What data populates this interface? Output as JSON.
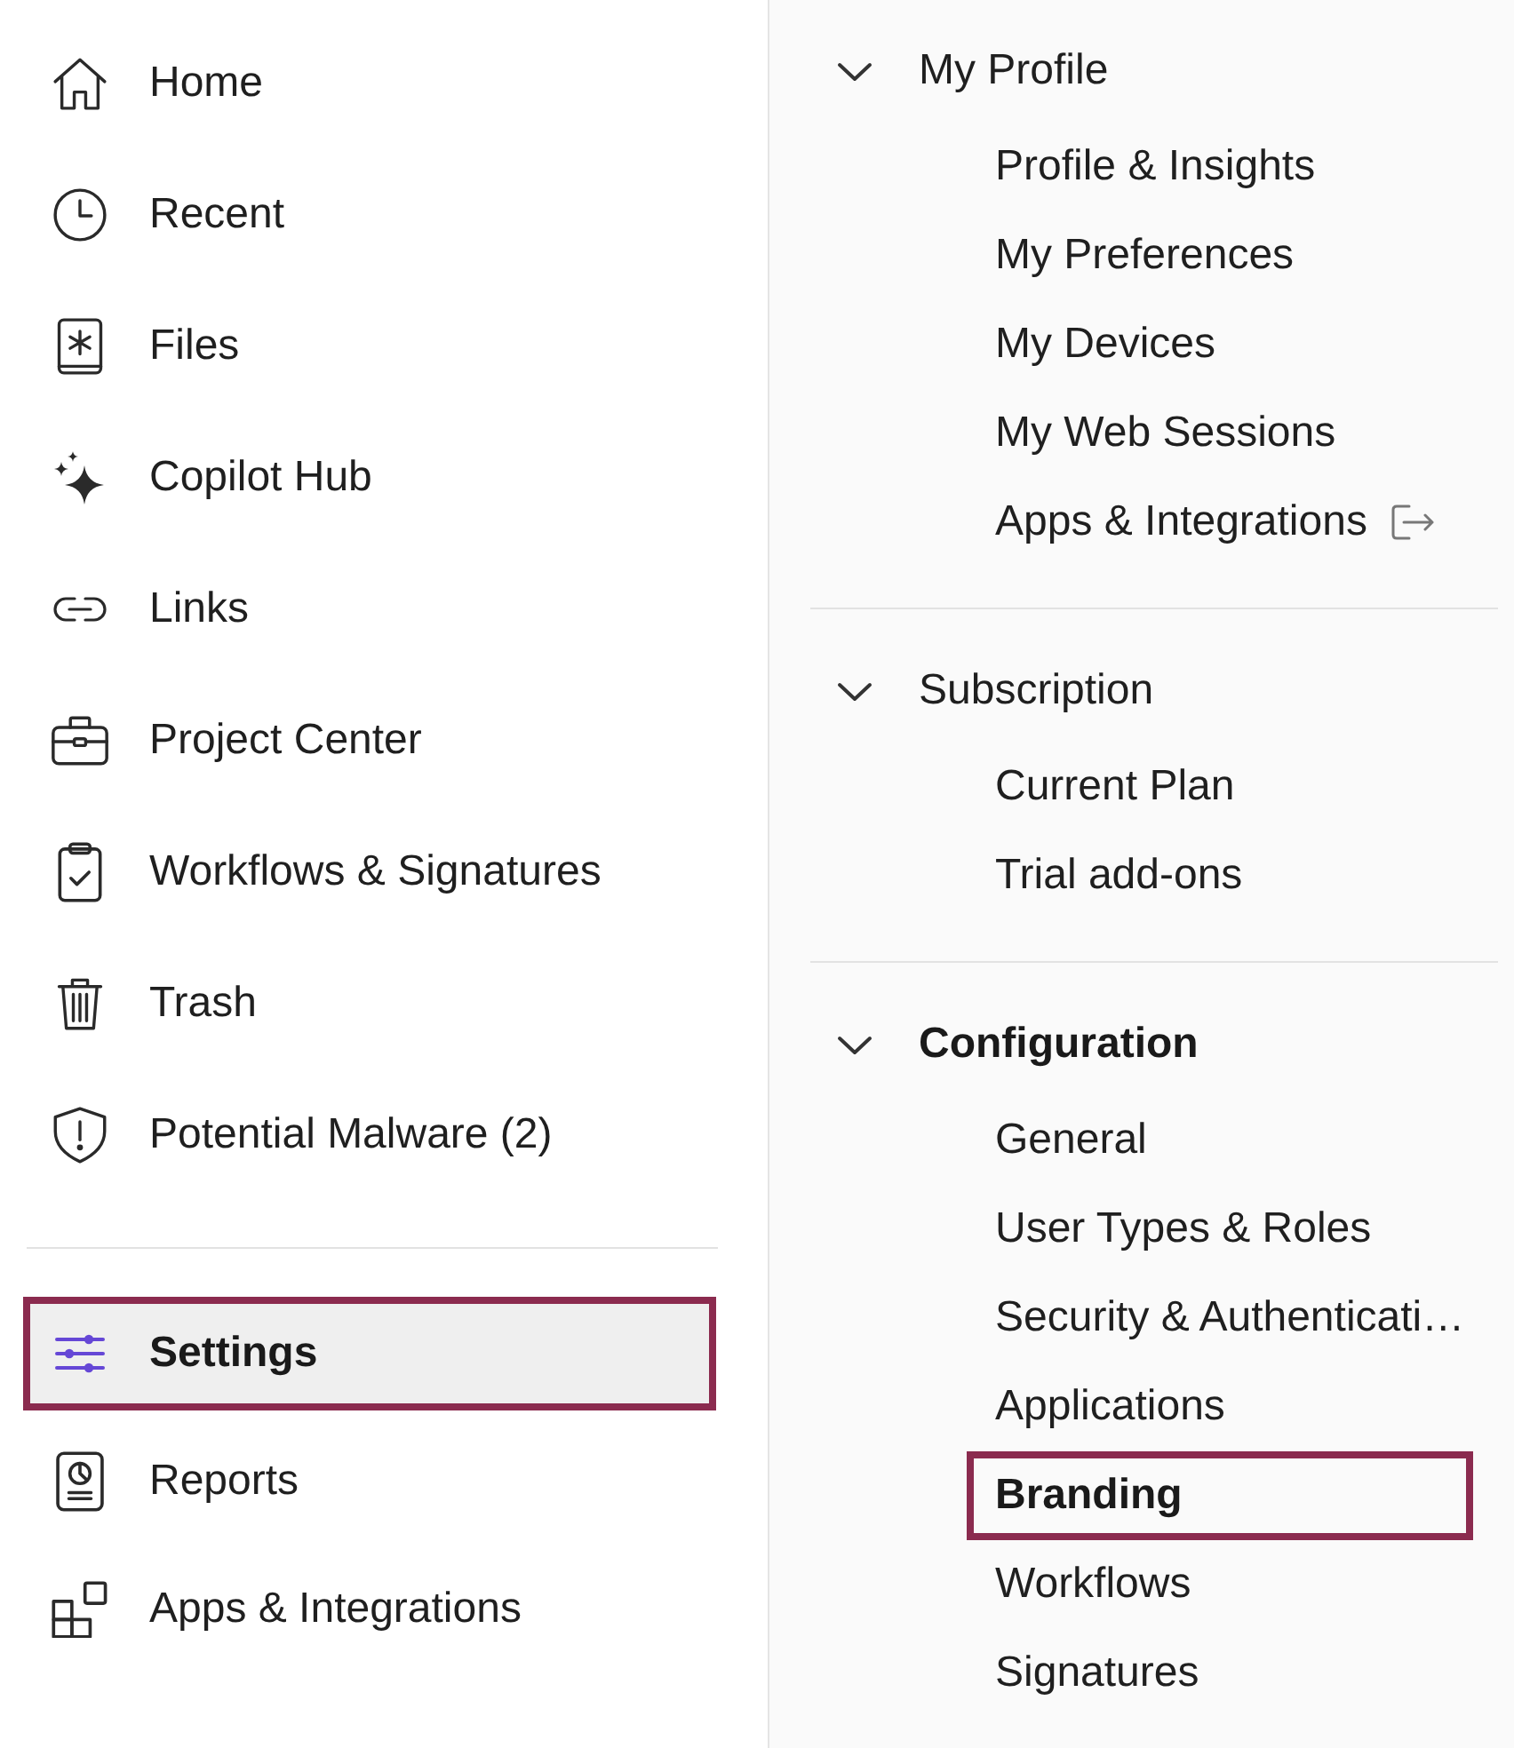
{
  "sidebar": {
    "items": [
      {
        "label": "Home",
        "selected": false,
        "highlighted": false
      },
      {
        "label": "Recent",
        "selected": false,
        "highlighted": false
      },
      {
        "label": "Files",
        "selected": false,
        "highlighted": false
      },
      {
        "label": "Copilot Hub",
        "selected": false,
        "highlighted": false
      },
      {
        "label": "Links",
        "selected": false,
        "highlighted": false
      },
      {
        "label": "Project Center",
        "selected": false,
        "highlighted": false
      },
      {
        "label": "Workflows & Signatures",
        "selected": false,
        "highlighted": false
      },
      {
        "label": "Trash",
        "selected": false,
        "highlighted": false
      },
      {
        "label": "Potential Malware (2)",
        "selected": false,
        "highlighted": false
      }
    ],
    "bottom_items": [
      {
        "label": "Settings",
        "selected": true,
        "highlighted": true
      },
      {
        "label": "Reports",
        "selected": false,
        "highlighted": false
      },
      {
        "label": "Apps & Integrations",
        "selected": false,
        "highlighted": false
      }
    ]
  },
  "settings_menu": {
    "sections": [
      {
        "title": "My Profile",
        "expanded": true,
        "active": false,
        "items": [
          {
            "label": "Profile & Insights",
            "selected": false,
            "highlighted": false,
            "external": false
          },
          {
            "label": "My Preferences",
            "selected": false,
            "highlighted": false,
            "external": false
          },
          {
            "label": "My Devices",
            "selected": false,
            "highlighted": false,
            "external": false
          },
          {
            "label": "My Web Sessions",
            "selected": false,
            "highlighted": false,
            "external": false
          },
          {
            "label": "Apps & Integrations",
            "selected": false,
            "highlighted": false,
            "external": true
          }
        ]
      },
      {
        "title": "Subscription",
        "expanded": true,
        "active": false,
        "items": [
          {
            "label": "Current Plan",
            "selected": false,
            "highlighted": false,
            "external": false
          },
          {
            "label": "Trial add-ons",
            "selected": false,
            "highlighted": false,
            "external": false
          }
        ]
      },
      {
        "title": "Configuration",
        "expanded": true,
        "active": true,
        "items": [
          {
            "label": "General",
            "selected": false,
            "highlighted": false,
            "external": false
          },
          {
            "label": "User Types & Roles",
            "selected": false,
            "highlighted": false,
            "external": false
          },
          {
            "label": "Security & Authenticati…",
            "selected": false,
            "highlighted": false,
            "external": false
          },
          {
            "label": "Applications",
            "selected": false,
            "highlighted": false,
            "external": false
          },
          {
            "label": "Branding",
            "selected": true,
            "highlighted": true,
            "external": false
          },
          {
            "label": "Workflows",
            "selected": false,
            "highlighted": false,
            "external": false
          },
          {
            "label": "Signatures",
            "selected": false,
            "highlighted": false,
            "external": false
          }
        ]
      }
    ]
  }
}
